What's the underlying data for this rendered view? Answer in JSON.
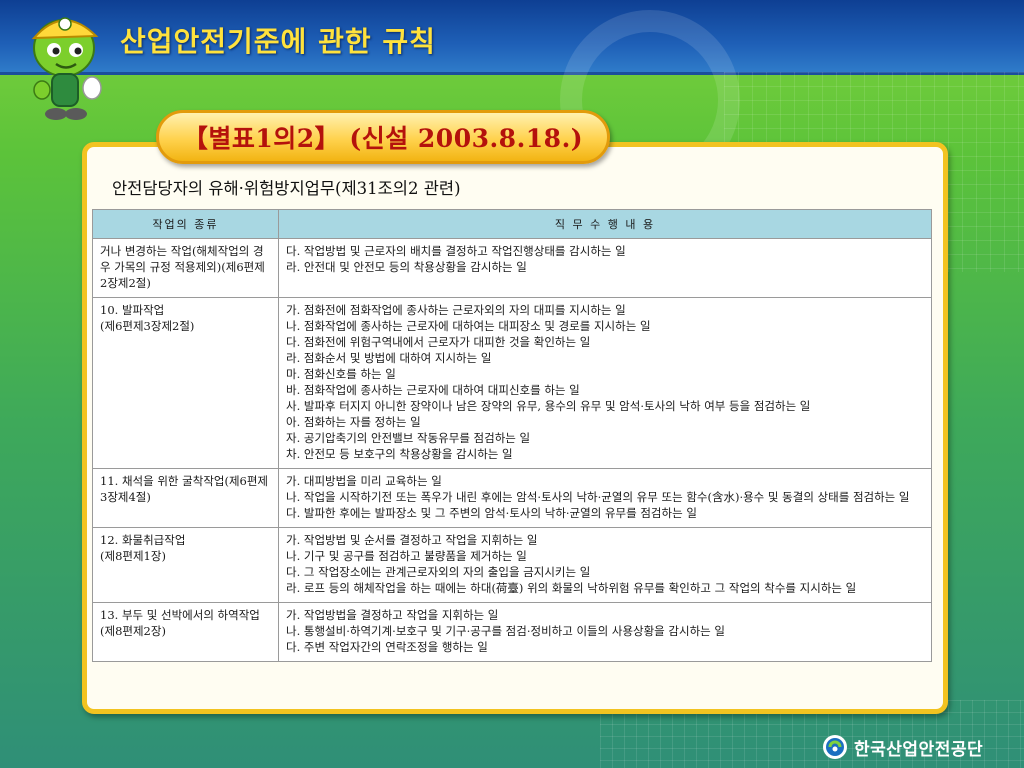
{
  "header": {
    "title": "산업안전기준에 관한 규칙"
  },
  "badge": "【별표1의2】 (신설 2003.8.18.)",
  "subtitle": "안전담당자의 유해·위험방지업무(제31조의2 관련)",
  "table": {
    "headers": [
      "작업의 종류",
      "직 무 수 행 내 용"
    ],
    "rows": [
      {
        "kind": "거나 변경하는 작업(해체작업의 경우 가목의 규정 적용제외)(제6편제2장제2절)",
        "duties": [
          "다. 작업방법 및 근로자의 배치를 결정하고 작업진행상태를 감시하는 일",
          "라. 안전대 및 안전모 등의 착용상황을 감시하는 일"
        ]
      },
      {
        "kind": "10. 발파작업\n(제6편제3장제2절)",
        "duties": [
          "가. 점화전에 점화작업에 종사하는 근로자외의 자의 대피를 지시하는 일",
          "나. 점화작업에 종사하는 근로자에 대하여는 대피장소 및 경로를 지시하는 일",
          "다. 점화전에 위험구역내에서 근로자가 대피한 것을 확인하는 일",
          "라. 점화순서 및 방법에 대하여 지시하는 일",
          "마. 점화신호를 하는 일",
          "바. 점화작업에 종사하는 근로자에 대하여 대피신호를 하는 일",
          "사. 발파후 터지지 아니한 장약이나 남은 장약의 유무, 용수의 유무 및 암석·토사의 낙하 여부 등을 점검하는 일",
          "아. 점화하는 자를 정하는 일",
          "자. 공기압축기의 안전밸브 작동유무를 점검하는 일",
          "차. 안전모 등 보호구의 착용상황을 감시하는 일"
        ]
      },
      {
        "kind": "11. 채석을 위한 굴착작업(제6편제3장제4절)",
        "duties": [
          "가. 대피방법을 미리 교육하는 일",
          "나. 작업을 시작하기전 또는 폭우가 내린 후에는 암석·토사의 낙하·균열의 유무 또는 함수(含水)·용수 및 동결의 상태를 점검하는 일",
          "다. 발파한 후에는 발파장소 및 그 주변의 암석·토사의 낙하·균열의 유무를 점검하는 일"
        ]
      },
      {
        "kind": "12. 화물취급작업\n(제8편제1장)",
        "duties": [
          "가. 작업방법 및 순서를 결정하고 작업을 지휘하는 일",
          "나. 기구 및 공구를 점검하고 불량품을 제거하는 일",
          "다. 그 작업장소에는 관계근로자외의 자의 출입을 금지시키는 일",
          "라. 로프 등의 해체작업을 하는 때에는 하대(荷臺) 위의 화물의 낙하위험 유무를 확인하고 그 작업의 착수를 지시하는 일"
        ]
      },
      {
        "kind": "13. 부두 및 선박에서의 하역작업(제8편제2장)",
        "duties": [
          "가. 작업방법을 결정하고 작업을 지휘하는 일",
          "나. 통행설비·하역기계·보호구 및 기구·공구를 점검·정비하고 이들의 사용상황을 감시하는 일",
          "다. 주변 작업자간의 연락조정을 행하는 일"
        ]
      }
    ]
  },
  "footer": {
    "org_name": "한국산업안전공단"
  },
  "icons": {
    "mascot": "mascot-icon",
    "logo": "logo-icon"
  },
  "colors": {
    "title": "#ffe23d",
    "badge_text": "#b4120c",
    "header_row": "#a8d7e2",
    "panel_border": "#f2c320"
  }
}
